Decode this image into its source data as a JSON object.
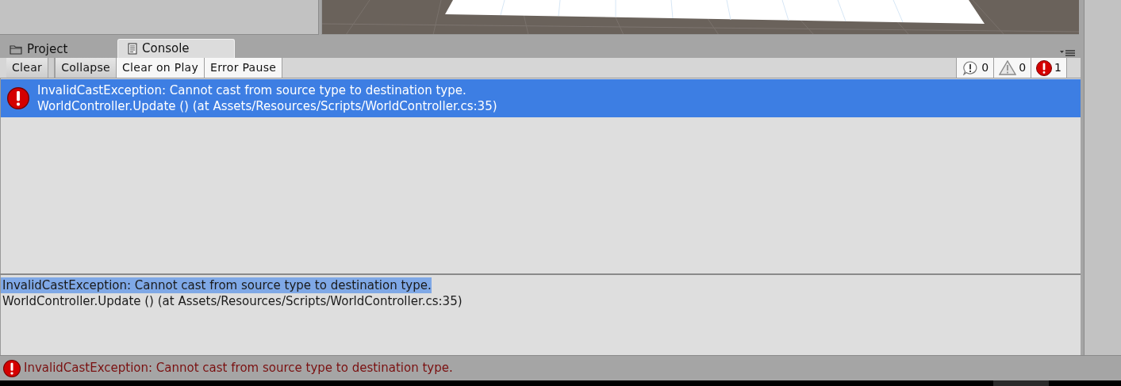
{
  "tabs": [
    {
      "label": "Project",
      "kind": "folder",
      "selected": false
    },
    {
      "label": "Console",
      "kind": "document",
      "selected": true
    }
  ],
  "toolbar": [
    {
      "label": "Clear",
      "on": false
    },
    {
      "label": "Collapse",
      "on": false
    },
    {
      "label": "Clear on Play",
      "on": true
    },
    {
      "label": "Error Pause",
      "on": true
    }
  ],
  "counters": [
    {
      "kind": "info",
      "count": "0"
    },
    {
      "kind": "warning",
      "count": "0"
    },
    {
      "kind": "error",
      "count": "1"
    }
  ],
  "log": [
    {
      "kind": "error",
      "selected": true,
      "message": "InvalidCastException: Cannot cast from source type to destination type.",
      "trace": "WorldController.Update () (at Assets/Resources/Scripts/WorldController.cs:35)"
    }
  ],
  "detail": [
    {
      "text": "InvalidCastException: Cannot cast from source type to destination type.",
      "highlighted": true
    },
    {
      "text": "WorldController.Update () (at Assets/Resources/Scripts/WorldController.cs:35)",
      "highlighted": false
    }
  ],
  "status_bar": {
    "kind": "error",
    "message": "InvalidCastException: Cannot cast from source type to destination type."
  }
}
